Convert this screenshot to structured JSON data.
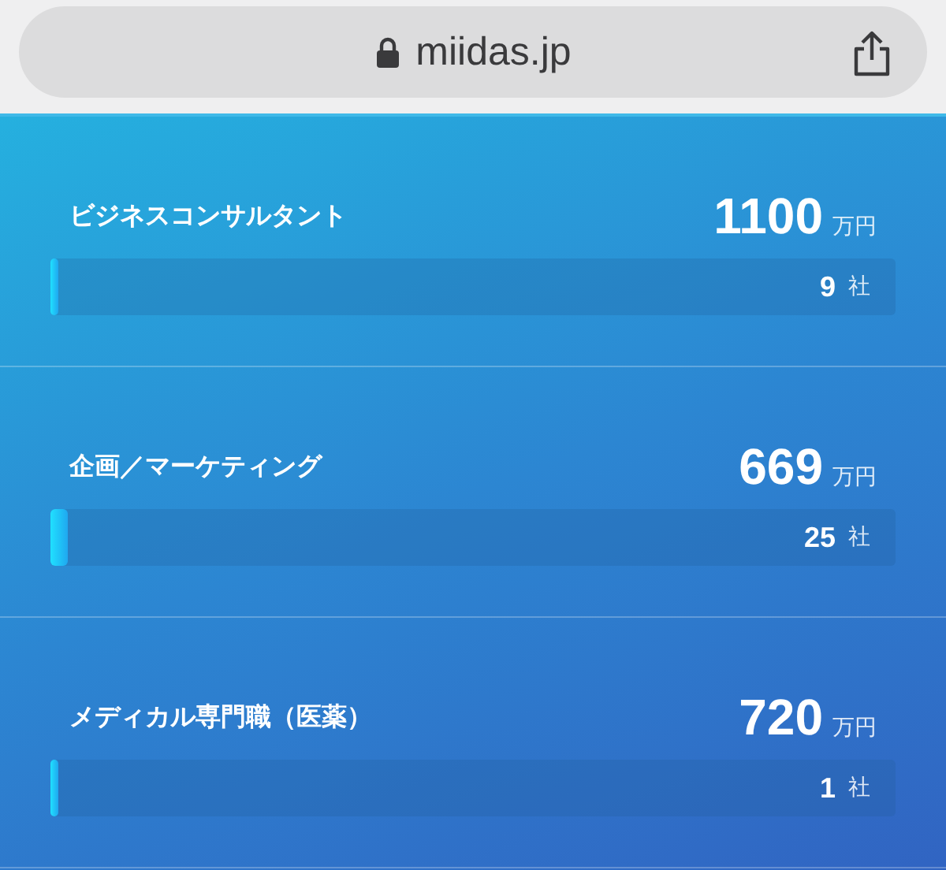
{
  "address_bar": {
    "url": "miidas.jp"
  },
  "jobs": [
    {
      "title": "ビジネスコンサルタント",
      "amount": "1100",
      "amount_unit": "万円",
      "count": "9",
      "count_unit": "社",
      "level": 0.01
    },
    {
      "title": "企画／マーケティング",
      "amount": "669",
      "amount_unit": "万円",
      "count": "25",
      "count_unit": "社",
      "level": 0.02
    },
    {
      "title": "メディカル専門職（医薬）",
      "amount": "720",
      "amount_unit": "万円",
      "count": "1",
      "count_unit": "社",
      "level": 0.01
    }
  ]
}
